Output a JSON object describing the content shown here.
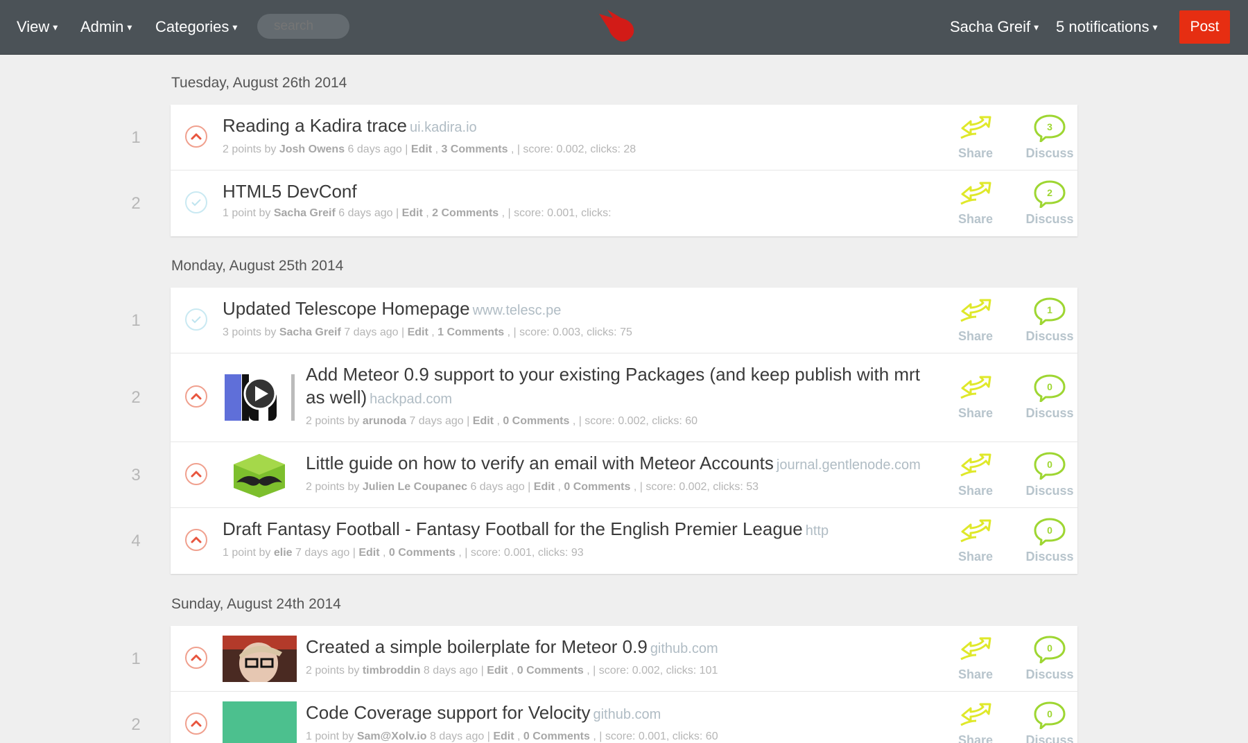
{
  "nav": {
    "view": "View",
    "admin": "Admin",
    "categories": "Categories",
    "search_placeholder": "search",
    "user": "Sacha Greif",
    "notifications": "5 notifications",
    "post": "Post",
    "caret": "▾"
  },
  "colors": {
    "nav_bg": "#4b5257",
    "post_button": "#e62e12",
    "logo": "#d21b17",
    "share_icon": "#dfe82a",
    "discuss_icon": "#9ed632",
    "upvote": "#e8553e",
    "voted": "#bfe4ef"
  },
  "labels": {
    "share": "Share",
    "discuss": "Discuss"
  },
  "days": [
    {
      "date": "Tuesday, August 26th 2014",
      "posts": [
        {
          "rank": "1",
          "voted": false,
          "title": "Reading a Kadira trace",
          "domain": "ui.kadira.io",
          "points": "2 points by",
          "author": "Josh Owens",
          "ago": "6 days ago",
          "edit": "Edit",
          "comments": "3 Comments",
          "stats": "| score: 0.002, clicks: 28",
          "comment_count": "3",
          "thumb": ""
        },
        {
          "rank": "2",
          "voted": true,
          "title": "HTML5 DevConf",
          "domain": "",
          "points": "1 point by",
          "author": "Sacha Greif",
          "ago": "6 days ago",
          "edit": "Edit",
          "comments": "2 Comments",
          "stats": "| score: 0.001, clicks:",
          "comment_count": "2",
          "thumb": ""
        }
      ]
    },
    {
      "date": "Monday, August 25th 2014",
      "posts": [
        {
          "rank": "1",
          "voted": true,
          "title": "Updated Telescope Homepage",
          "domain": "www.telesc.pe",
          "points": "3 points by",
          "author": "Sacha Greif",
          "ago": "7 days ago",
          "edit": "Edit",
          "comments": "1 Comments",
          "stats": "| score: 0.003, clicks: 75",
          "comment_count": "1",
          "thumb": ""
        },
        {
          "rank": "2",
          "voted": false,
          "title": "Add Meteor 0.9 support to your existing Packages (and keep publish with mrt as well)",
          "domain": "hackpad.com",
          "points": "2 points by",
          "author": "arunoda",
          "ago": "7 days ago",
          "edit": "Edit",
          "comments": "0 Comments",
          "stats": "| score: 0.002, clicks: 60",
          "comment_count": "0",
          "thumb": "hackpad-video-thumbnail"
        },
        {
          "rank": "3",
          "voted": false,
          "title": "Little guide on how to verify an email with Meteor Accounts",
          "domain": "journal.gentlenode.com",
          "points": "2 points by",
          "author": "Julien Le Coupanec",
          "ago": "6 days ago",
          "edit": "Edit",
          "comments": "0 Comments",
          "stats": "| score: 0.002, clicks: 53",
          "comment_count": "0",
          "thumb": "mustache-hexagon-logo"
        },
        {
          "rank": "4",
          "voted": false,
          "title": "Draft Fantasy Football - Fantasy Football for the English Premier League",
          "domain": "http",
          "points": "1 point by",
          "author": "elie",
          "ago": "7 days ago",
          "edit": "Edit",
          "comments": "0 Comments",
          "stats": "| score: 0.001, clicks: 93",
          "comment_count": "0",
          "thumb": ""
        }
      ]
    },
    {
      "date": "Sunday, August 24th 2014",
      "posts": [
        {
          "rank": "1",
          "voted": false,
          "title": "Created a simple boilerplate for Meteor 0.9",
          "domain": "github.com",
          "points": "2 points by",
          "author": "timbroddin",
          "ago": "8 days ago",
          "edit": "Edit",
          "comments": "0 Comments",
          "stats": "| score: 0.002, clicks: 101",
          "comment_count": "0",
          "thumb": "avatar-photo"
        },
        {
          "rank": "2",
          "voted": false,
          "title": "Code Coverage support for Velocity",
          "domain": "github.com",
          "points": "1 point by",
          "author": "Sam@Xolv.io",
          "ago": "8 days ago",
          "edit": "Edit",
          "comments": "0 Comments",
          "stats": "| score: 0.001, clicks: 60",
          "comment_count": "0",
          "thumb": "green-thumbnail"
        }
      ]
    }
  ]
}
